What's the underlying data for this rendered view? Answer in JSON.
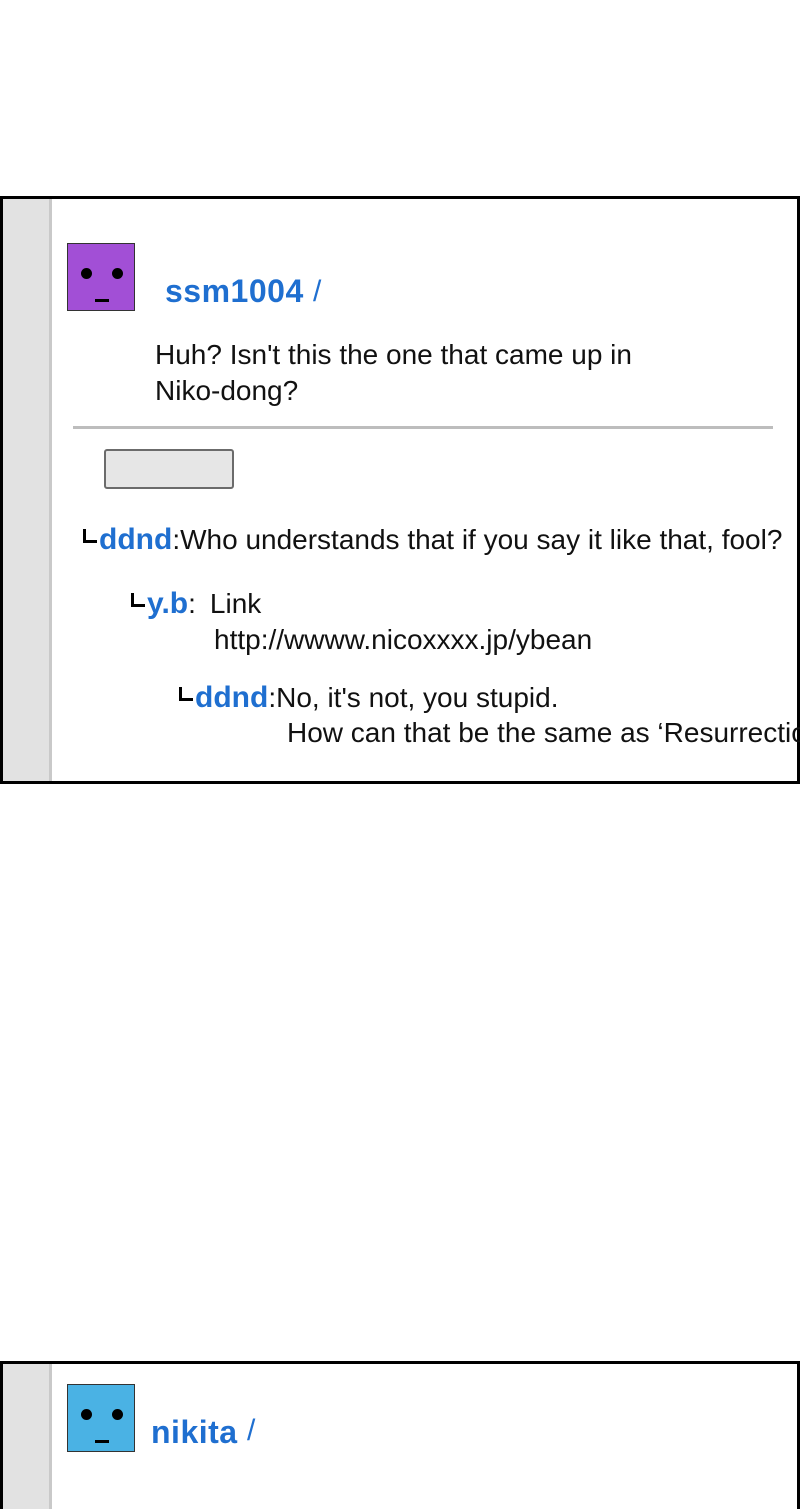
{
  "posts": [
    {
      "username": "ssm1004",
      "slash": "/",
      "avatar_color": "#a24fd6",
      "text_lines": [
        "Huh? Isn't this the one that came up in",
        "Niko-dong?"
      ],
      "replies": [
        {
          "name": "ddnd",
          "sep": ":",
          "lines": [
            "Who understands that if you say it like that, fool?"
          ]
        },
        {
          "name": "y.b",
          "sep": ":",
          "lines": [
            "Link",
            "http://wwww.nicoxxxx.jp/ybean"
          ]
        },
        {
          "name": "ddnd",
          "sep": ":",
          "lines": [
            "No, it's not, you stupid.",
            "How can that be the same as ‘Resurrection’"
          ]
        }
      ]
    },
    {
      "username": "nikita",
      "slash": "/",
      "avatar_color": "#4ab2e4"
    }
  ]
}
